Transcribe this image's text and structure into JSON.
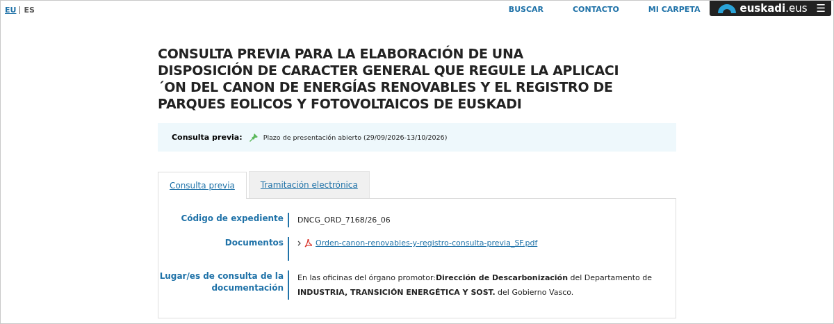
{
  "languages": [
    {
      "label": "EU",
      "selected": true
    },
    {
      "label": "ES",
      "selected": false
    }
  ],
  "nav": [
    "BUSCAR",
    "CONTACTO",
    "MI CARPETA"
  ],
  "logo": {
    "text": "**euskadi**.eus",
    "menu": "☰"
  },
  "title": "CONSULTA PREVIA PARA LA ELABORACIÓN DE UNA\nDISPOSICIÓN DE CARACTER GENERAL QUE REGULE LA APLICACI\n´ON DEL CANON DE ENERGÍAS RENOVABLES Y EL REGISTRO DE\nPARQUES EOLICOS Y FOTOVOLTAICOS DE EUSKADI",
  "status": {
    "label": "Consulta previa:",
    "value": "Plazo de presentación abierto (29/09/2026-13/10/2026)"
  },
  "tabs": [
    {
      "label": "Consulta previa",
      "selected": true
    },
    {
      "label": "Tramitación electrónica",
      "selected": false
    }
  ],
  "fields": [
    {
      "kind": "text",
      "label": "Código de expediente",
      "value": "DNCG_ORD_7168/26_06"
    },
    {
      "kind": "document",
      "label": "Documentos",
      "value": "Orden-canon-renovables-y-registro-consulta-previa_SF.pdf"
    },
    {
      "kind": "text",
      "label": "Lugar/es de consulta de la documentación",
      "value": "En las oficinas del órgano promotor:**Dirección de Descarbonización** del Departamento de **INDUSTRIA, TRANSICIÓN ENERGÉTICA Y SOST.** del Gobierno Vasco."
    }
  ]
}
